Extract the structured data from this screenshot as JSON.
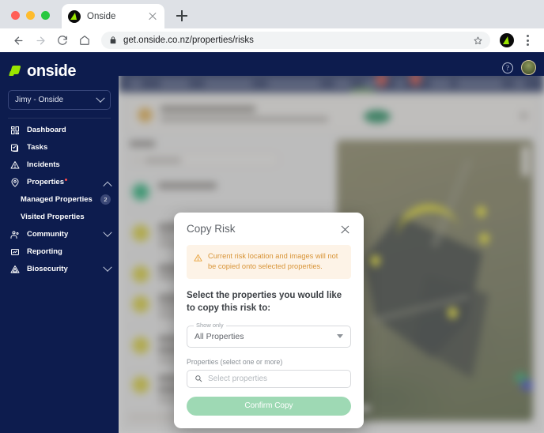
{
  "browser": {
    "tab": {
      "title": "Onside",
      "favicon": "onside-bolt-icon",
      "close": "×"
    },
    "new_tab_label": "+",
    "toolbar": {
      "back": "back-arrow-icon",
      "forward": "forward-arrow-icon",
      "reload": "reload-icon",
      "home": "home-icon",
      "lock": "lock-icon",
      "url": "get.onside.co.nz/properties/risks",
      "bookmark": "star-icon",
      "extension": "onside-extension-icon",
      "menu": "kebab-menu-icon"
    }
  },
  "sidebar": {
    "brand": "onside",
    "org_selector": {
      "value": "Jimy - Onside",
      "chevron": "chevron-down-icon"
    },
    "items": [
      {
        "label": "Dashboard",
        "icon": "dashboard-icon",
        "expandable": false
      },
      {
        "label": "Tasks",
        "icon": "tasks-icon",
        "expandable": false
      },
      {
        "label": "Incidents",
        "icon": "incidents-warning-icon",
        "expandable": false
      },
      {
        "label": "Properties",
        "icon": "properties-pin-icon",
        "expandable": true,
        "expanded": true,
        "has_dot": true
      },
      {
        "label": "Community",
        "icon": "community-people-icon",
        "expandable": true,
        "expanded": false
      },
      {
        "label": "Reporting",
        "icon": "reporting-chart-icon",
        "expandable": false
      },
      {
        "label": "Biosecurity",
        "icon": "biosecurity-icon",
        "expandable": true,
        "expanded": false
      }
    ],
    "sub_items": [
      {
        "label": "Managed Properties",
        "badge": "2"
      },
      {
        "label": "Visited Properties",
        "badge": ""
      }
    ]
  },
  "app_header": {
    "help": "?",
    "help_icon": "help-circle-icon",
    "avatar": "user-avatar"
  },
  "modal": {
    "title": "Copy Risk",
    "close_icon": "close-icon",
    "alert": {
      "icon": "warning-triangle-icon",
      "text": "Current risk location and images will not be copied onto selected properties."
    },
    "prompt": "Select the properties you would like to copy this risk to:",
    "show_only": {
      "legend": "Show only",
      "value": "All Properties",
      "caret": "caret-down-icon"
    },
    "properties": {
      "label": "Properties (select one or more)",
      "search_icon": "search-icon",
      "placeholder": "Select properties"
    },
    "confirm_label": "Confirm Copy"
  },
  "colors": {
    "sidebar_navy": "#0d1c4e",
    "brand_green": "#9ae600",
    "alert_bg": "#fdf3e7",
    "alert_text": "#d89437",
    "confirm_btn": "#9ed9b4",
    "map_pin_yellow": "#ece52b"
  }
}
